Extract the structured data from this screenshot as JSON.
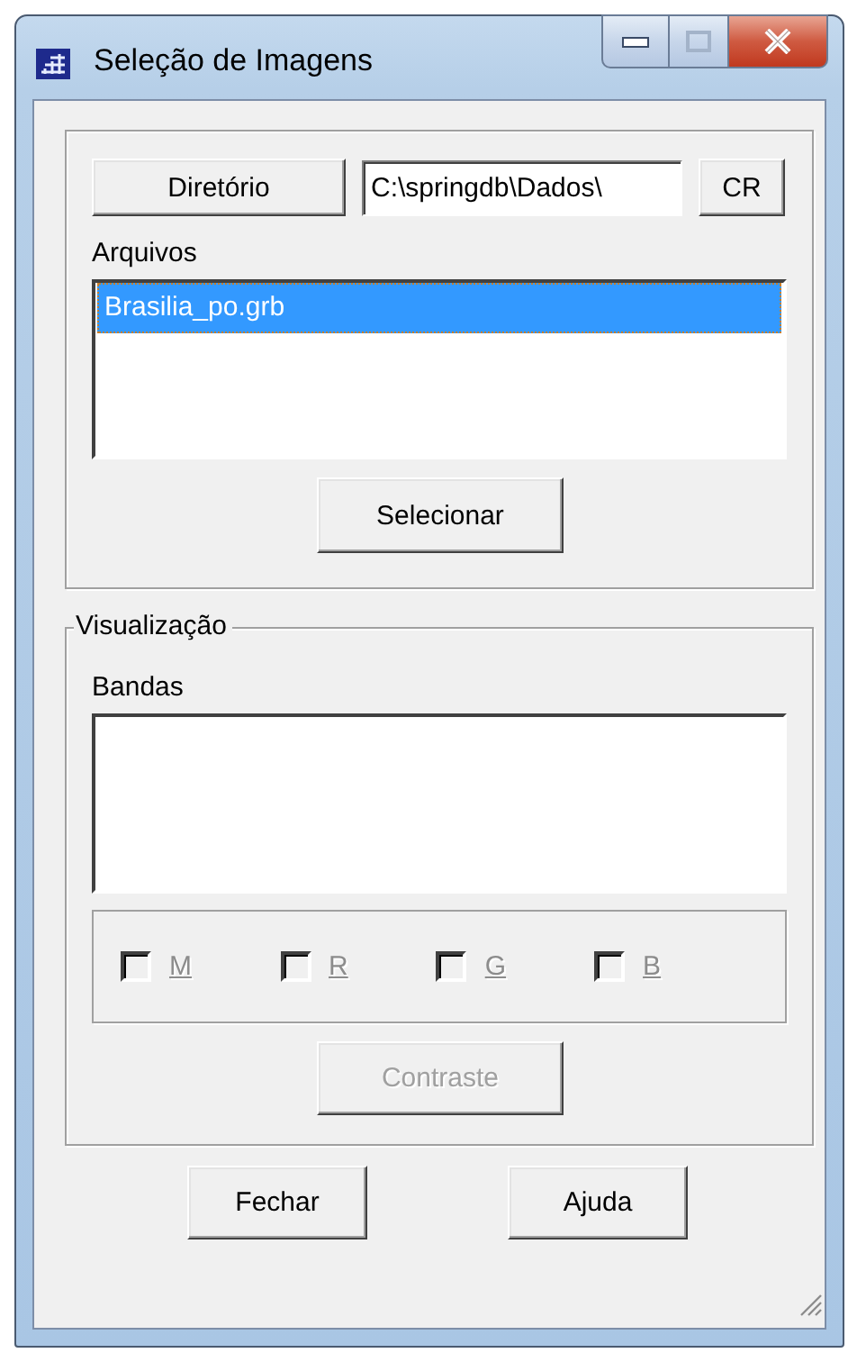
{
  "window": {
    "title": "Seleção de Imagens"
  },
  "files_group": {
    "directory_button": {
      "label": "Diretório",
      "disabled": false
    },
    "directory_field": {
      "value": "C:\\springdb\\Dados\\"
    },
    "cr_button": {
      "label": "CR",
      "disabled": false
    },
    "files_label": "Arquivos",
    "files": [
      {
        "name": "Brasilia_po.grb",
        "selected": true
      }
    ],
    "select_button": {
      "label": "Selecionar",
      "disabled": false
    }
  },
  "visualization_group": {
    "legend": "Visualização",
    "bands_label": "Bandas",
    "channels": [
      {
        "label": "M",
        "checked": false,
        "disabled": true
      },
      {
        "label": "R",
        "checked": false,
        "disabled": true
      },
      {
        "label": "G",
        "checked": false,
        "disabled": true
      },
      {
        "label": "B",
        "checked": false,
        "disabled": true
      }
    ],
    "contrast_button": {
      "label": "Contraste",
      "disabled": true
    }
  },
  "buttons": [
    {
      "label": "Fechar",
      "disabled": false
    },
    {
      "label": "Ajuda",
      "disabled": false
    }
  ]
}
